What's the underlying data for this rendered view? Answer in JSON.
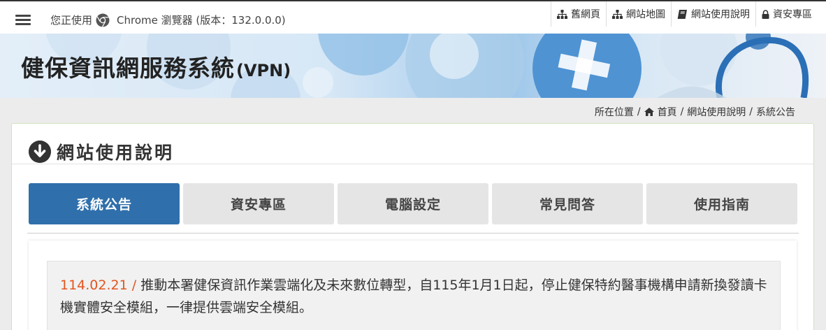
{
  "topbar": {
    "browser_prefix": "您正使用",
    "browser_text": "Chrome 瀏覽器 (版本：132.0.0.0)",
    "links": [
      {
        "label": "舊網頁",
        "icon": "sitemap-icon"
      },
      {
        "label": "網站地圖",
        "icon": "sitemap-icon"
      },
      {
        "label": "網站使用說明",
        "icon": "book-icon"
      },
      {
        "label": "資安專區",
        "icon": "lock-icon"
      }
    ]
  },
  "banner": {
    "title": "健保資訊網服務系統",
    "title_suffix": "(VPN)"
  },
  "breadcrumb": {
    "label": "所在位置",
    "items": [
      "首頁",
      "網站使用說明",
      "系統公告"
    ]
  },
  "panel": {
    "title": "網站使用說明",
    "tabs": [
      {
        "label": "系統公告",
        "active": true
      },
      {
        "label": "資安專區",
        "active": false
      },
      {
        "label": "電腦設定",
        "active": false
      },
      {
        "label": "常見問答",
        "active": false
      },
      {
        "label": "使用指南",
        "active": false
      }
    ]
  },
  "announcements": [
    {
      "date": "114.02.21 /",
      "text": "推動本署健保資訊作業雲端化及未來數位轉型，自115年1月1日起，停止健保特約醫事機構申請新換發讀卡機實體安全模組，一律提供雲端安全模組。"
    }
  ],
  "colors": {
    "tab_active": "#2f6fab",
    "tab_inactive": "#e5e5e5",
    "date_accent": "#e2551e"
  }
}
